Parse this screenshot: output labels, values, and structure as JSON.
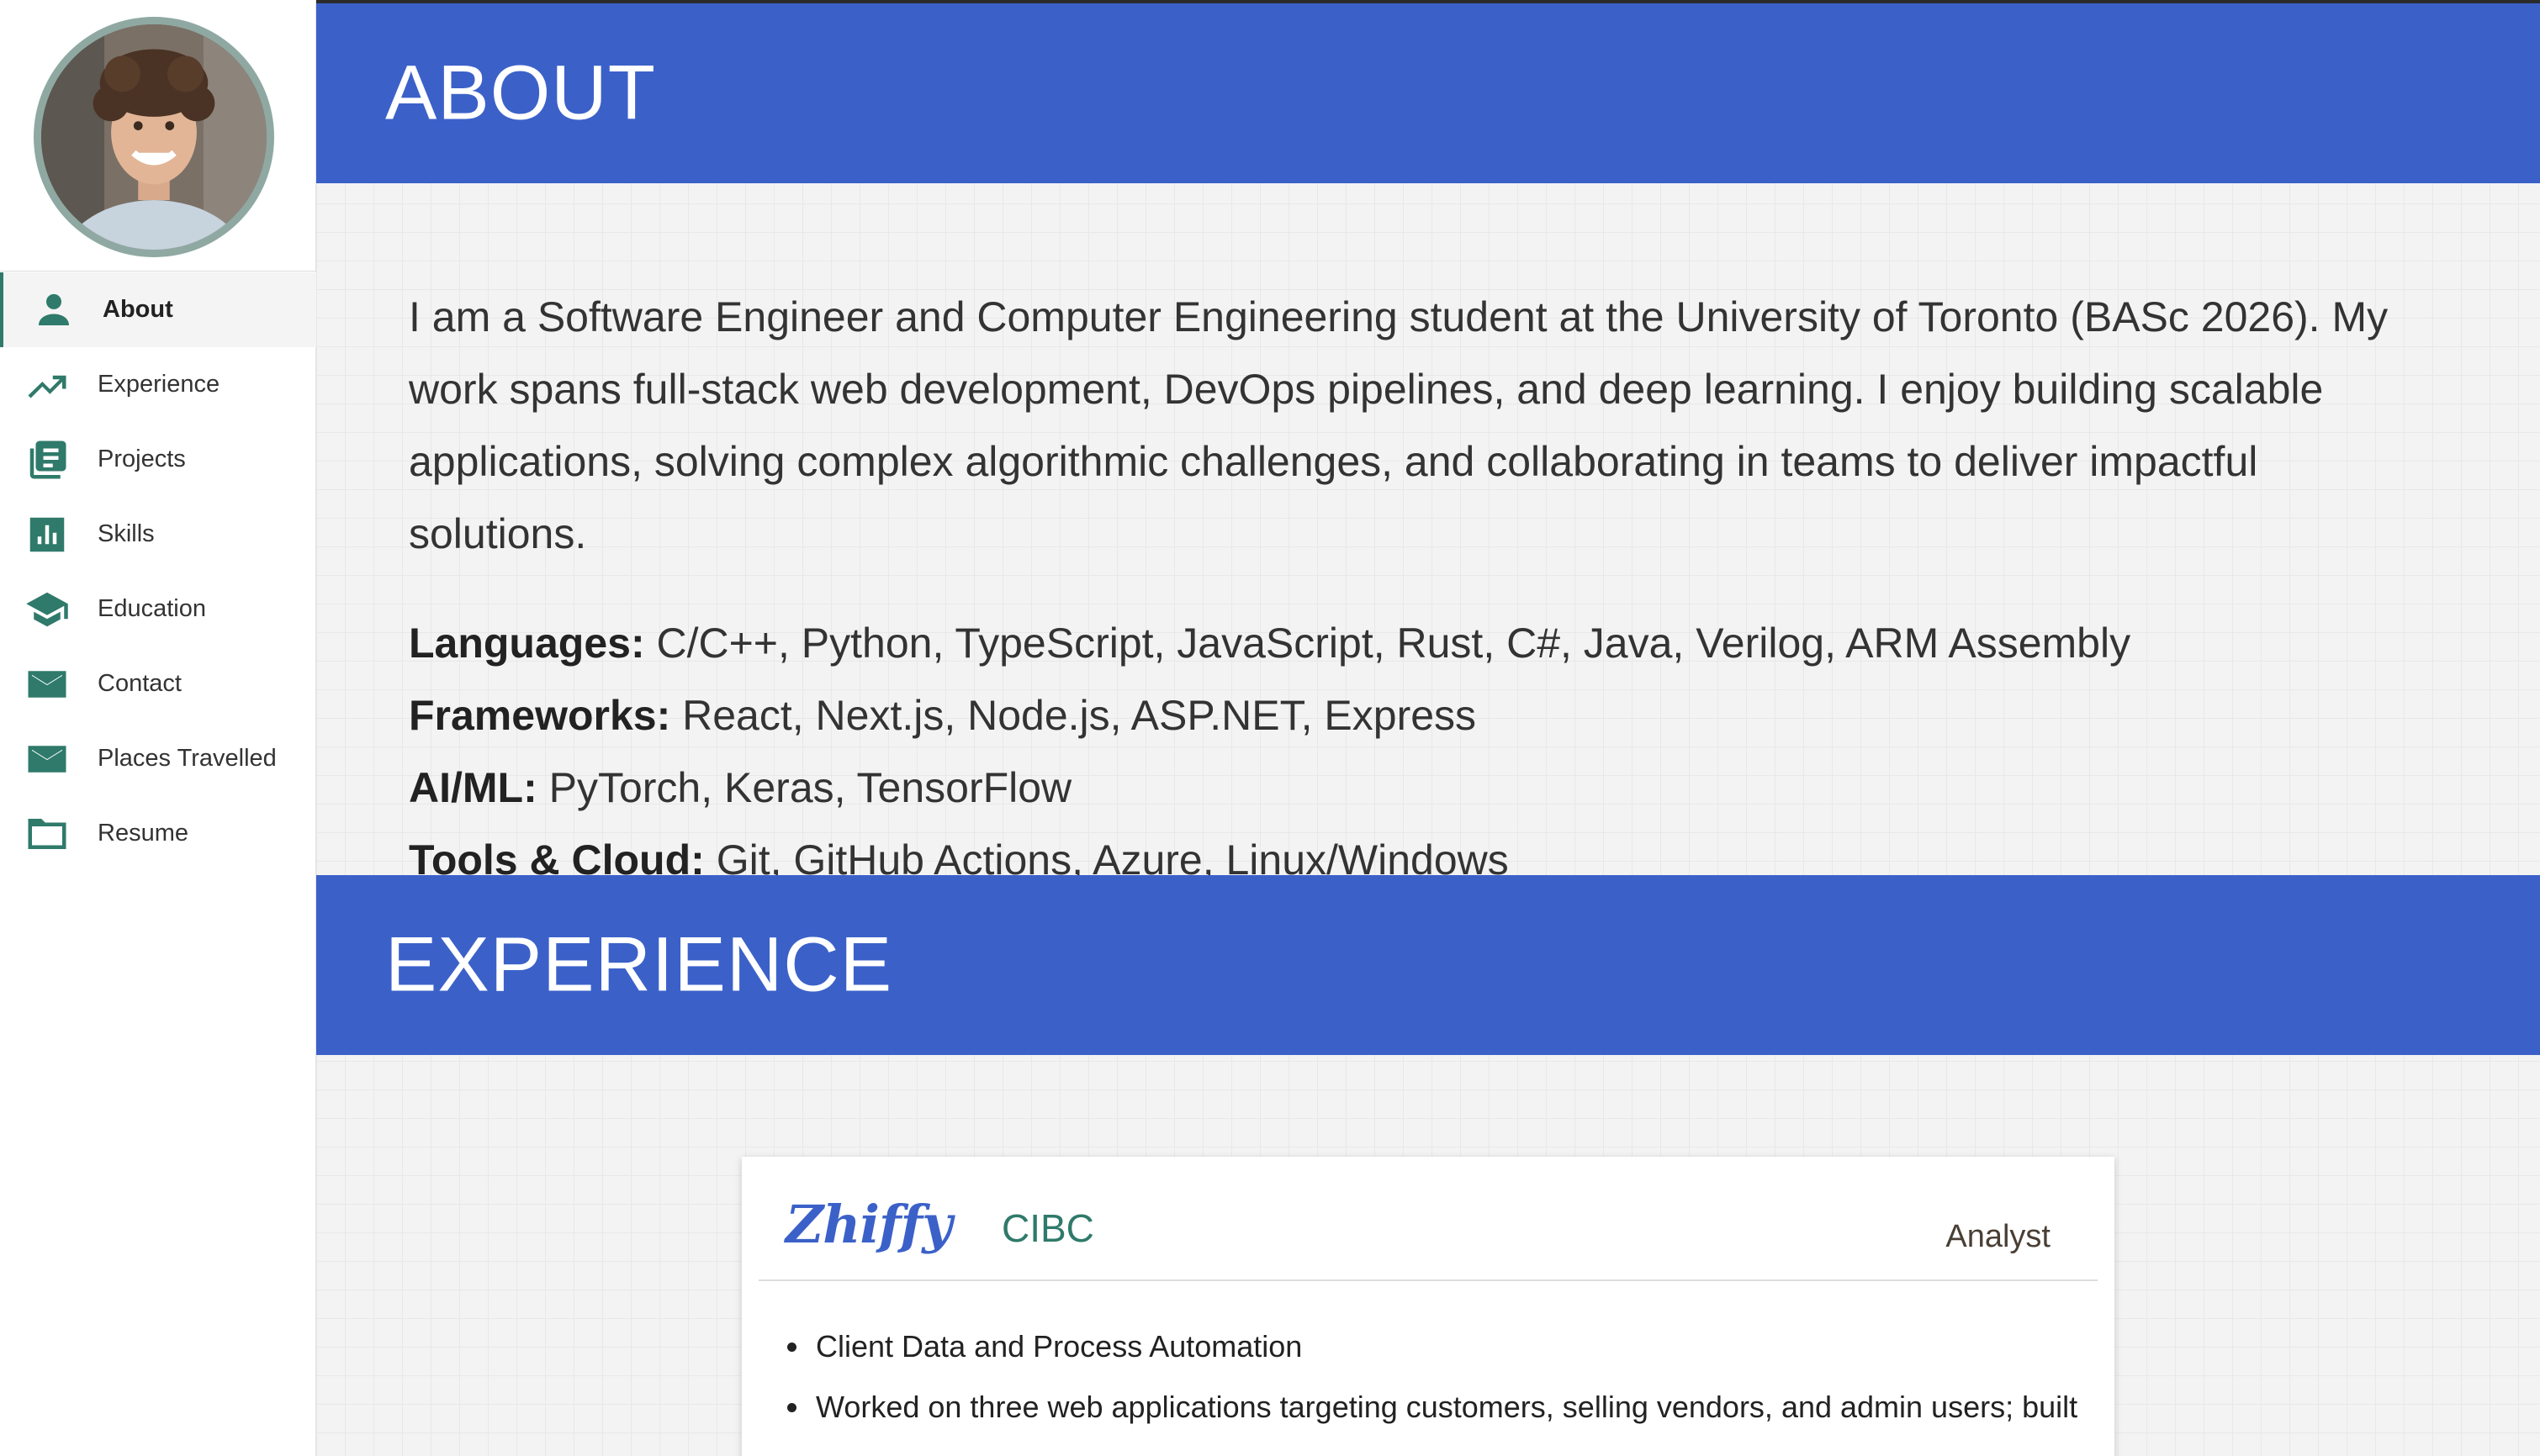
{
  "sidebar": {
    "items": [
      {
        "label": "About",
        "icon": "person-icon",
        "active": true
      },
      {
        "label": "Experience",
        "icon": "trending-up-icon"
      },
      {
        "label": "Projects",
        "icon": "projects-list-icon"
      },
      {
        "label": "Skills",
        "icon": "bar-chart-icon"
      },
      {
        "label": "Education",
        "icon": "graduation-cap-icon"
      },
      {
        "label": "Contact",
        "icon": "mail-icon"
      },
      {
        "label": "Places Travelled",
        "icon": "mail-icon"
      },
      {
        "label": "Resume",
        "icon": "folder-icon"
      }
    ]
  },
  "about": {
    "title": "ABOUT",
    "paragraph": "I am a Software Engineer and Computer Engineering student at the University of Toronto (BASc 2026). My work spans full-stack web development, DevOps pipelines, and deep learning. I enjoy building scalable applications, solving complex algorithmic challenges, and collaborating in teams to deliver impactful solutions.",
    "skills": [
      {
        "key": "Languages:",
        "value": " C/C++, Python, TypeScript, JavaScript, Rust, C#, Java, Verilog, ARM Assembly"
      },
      {
        "key": "Frameworks:",
        "value": " React, Next.js, Node.js, ASP.NET, Express"
      },
      {
        "key": "AI/ML:",
        "value": " PyTorch, Keras, TensorFlow"
      },
      {
        "key": "Tools & Cloud:",
        "value": " Git, GitHub Actions, Azure, Linux/Windows"
      }
    ]
  },
  "experience": {
    "title": "EXPERIENCE",
    "card": {
      "logo": "Zhiffy",
      "company": "CIBC",
      "role": "Analyst",
      "bullets": [
        "Client Data and Process Automation",
        "Worked on three web applications targeting customers, selling vendors, and admin users; built"
      ]
    }
  },
  "colors": {
    "band": "#3b61c9",
    "accent": "#2f7a6a"
  }
}
